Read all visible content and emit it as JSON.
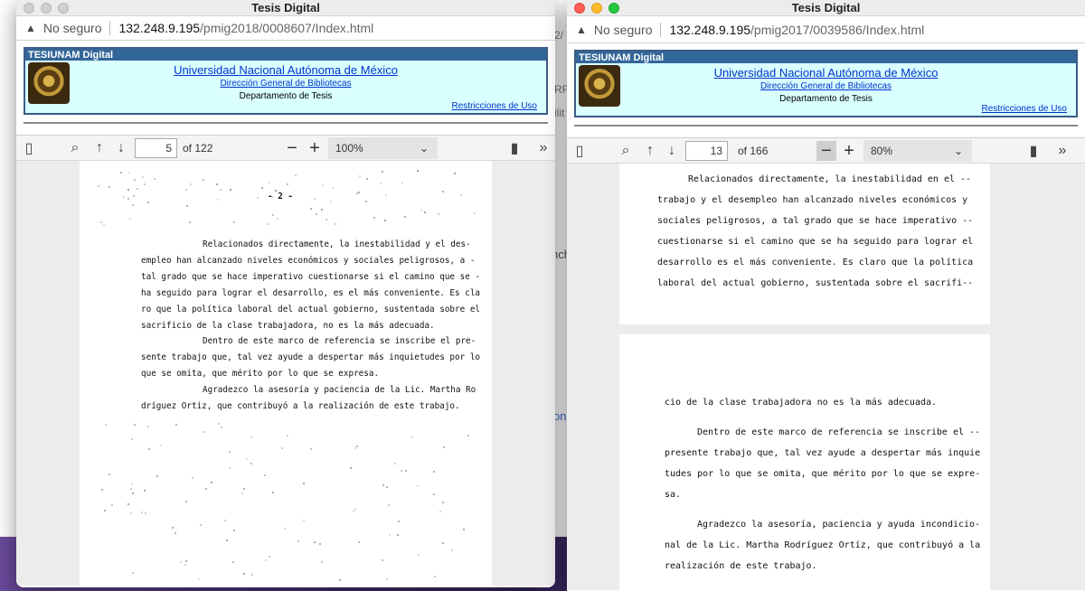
{
  "left": {
    "title": "Tesis Digital",
    "security": "No seguro",
    "url_host": "132.248.9.195",
    "url_path": "/pmig2018/0008607/Index.html",
    "header": {
      "brand": "TESIUNAM Digital",
      "university": "Universidad Nacional Autónoma de México",
      "directorate": "Dirección General de Bibliotecas",
      "department": "Departamento de Tesis",
      "restrictions": "Restricciones de Uso"
    },
    "toolbar": {
      "page": "5",
      "of_pages": "of 122",
      "zoom": "100%"
    },
    "page_number": "- 2 -",
    "lines": [
      "Relacionados directamente, la inestabilidad y el des-",
      "empleo han alcanzado niveles económicos y sociales peligrosos, a -",
      "tal grado que se hace imperativo cuestionarse si el camino que se -",
      "ha seguido para lograr el desarrollo, es el más conveniente. Es cla",
      "ro que la política laboral del actual gobierno, sustentada sobre el",
      "sacrificio de la clase trabajadora, no es la más adecuada.",
      "Dentro de este marco de referencia se inscribe el pre-",
      "sente trabajo que, tal vez ayude a despertar más inquietudes por lo",
      "que se omita, que mérito por lo que se expresa.",
      "Agradezco la asesoría y paciencia de la Lic. Martha Ro",
      "dríguez Ortiz, que contribuyó a la realización de este trabajo."
    ]
  },
  "right": {
    "title": "Tesis Digital",
    "security": "No seguro",
    "url_host": "132.248.9.195",
    "url_path": "/pmig2017/0039586/Index.html",
    "header": {
      "brand": "TESIUNAM Digital",
      "university": "Universidad Nacional Autónoma de México",
      "directorate": "Dirección General de Bibliotecas",
      "department": "Departamento de Tesis",
      "restrictions": "Restricciones de Uso"
    },
    "toolbar": {
      "page": "13",
      "of_pages": "of 166",
      "zoom": "80%"
    },
    "page1_lines": [
      "Relacionados directamente, la inestabilidad en el --",
      "trabajo y el desempleo han alcanzado niveles económicos y",
      "sociales peligrosos, a tal grado que se hace imperativo --",
      "cuestionarse si el camino que se ha seguido para lograr el",
      "desarrollo es el más conveniente. Es claro que la política",
      "laboral del actual gobierno, sustentada sobre el sacrifi--"
    ],
    "page2_lines": [
      "cio de la clase trabajadora no es la más adecuada.",
      "Dentro de este marco de referencia se inscribe el --",
      "presente trabajo que, tal vez ayude a despertar más inquie",
      "tudes por lo que se omita, que mérito por lo que se expre-",
      "sa.",
      "Agradezco la asesoría, paciencia y ayuda incondicio-",
      "nal de la Lic. Martha Rodríguez Ortíz, que contribuyó a la",
      "realización de este trabajo."
    ]
  },
  "background": {
    "fragments": [
      "2/",
      "RF",
      "ilit",
      "ncho",
      "on"
    ]
  }
}
